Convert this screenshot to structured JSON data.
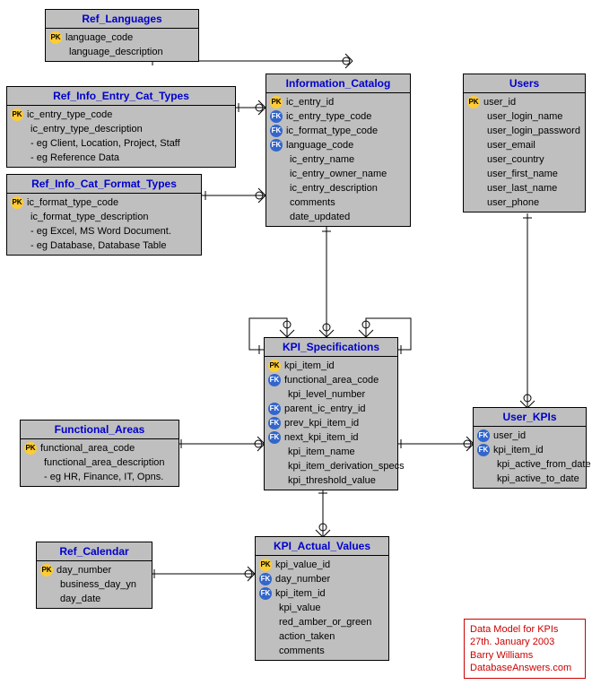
{
  "entities": {
    "ref_languages": {
      "title": "Ref_Languages",
      "attrs": [
        {
          "key": "pk",
          "name": "language_code"
        },
        {
          "key": "",
          "name": "language_description"
        }
      ]
    },
    "ref_info_entry_cat_types": {
      "title": "Ref_Info_Entry_Cat_Types",
      "attrs": [
        {
          "key": "pk",
          "name": "ic_entry_type_code"
        },
        {
          "key": "",
          "name": "ic_entry_type_description"
        },
        {
          "key": "",
          "name": "- eg Client, Location, Project, Staff"
        },
        {
          "key": "",
          "name": "- eg Reference Data"
        }
      ]
    },
    "ref_info_cat_format_types": {
      "title": "Ref_Info_Cat_Format_Types",
      "attrs": [
        {
          "key": "pk",
          "name": "ic_format_type_code"
        },
        {
          "key": "",
          "name": "ic_format_type_description"
        },
        {
          "key": "",
          "name": "- eg Excel, MS Word Document."
        },
        {
          "key": "",
          "name": "- eg Database, Database Table"
        }
      ]
    },
    "information_catalog": {
      "title": "Information_Catalog",
      "attrs": [
        {
          "key": "pk",
          "name": "ic_entry_id"
        },
        {
          "key": "fk",
          "name": "ic_entry_type_code"
        },
        {
          "key": "fk",
          "name": "ic_format_type_code"
        },
        {
          "key": "fk",
          "name": "language_code"
        },
        {
          "key": "",
          "name": "ic_entry_name"
        },
        {
          "key": "",
          "name": "ic_entry_owner_name"
        },
        {
          "key": "",
          "name": "ic_entry_description"
        },
        {
          "key": "",
          "name": "comments"
        },
        {
          "key": "",
          "name": "date_updated"
        }
      ]
    },
    "users": {
      "title": "Users",
      "attrs": [
        {
          "key": "pk",
          "name": "user_id"
        },
        {
          "key": "",
          "name": "user_login_name"
        },
        {
          "key": "",
          "name": "user_login_password"
        },
        {
          "key": "",
          "name": "user_email"
        },
        {
          "key": "",
          "name": "user_country"
        },
        {
          "key": "",
          "name": "user_first_name"
        },
        {
          "key": "",
          "name": "user_last_name"
        },
        {
          "key": "",
          "name": "user_phone"
        }
      ]
    },
    "kpi_specifications": {
      "title": "KPI_Specifications",
      "attrs": [
        {
          "key": "pk",
          "name": "kpi_item_id"
        },
        {
          "key": "fk",
          "name": "functional_area_code"
        },
        {
          "key": "",
          "name": "kpi_level_number"
        },
        {
          "key": "fk",
          "name": "parent_ic_entry_id"
        },
        {
          "key": "fk",
          "name": "prev_kpi_item_id"
        },
        {
          "key": "fk",
          "name": "next_kpi_item_id"
        },
        {
          "key": "",
          "name": "kpi_item_name"
        },
        {
          "key": "",
          "name": "kpi_item_derivation_specs"
        },
        {
          "key": "",
          "name": "kpi_threshold_value"
        }
      ]
    },
    "user_kpis": {
      "title": "User_KPIs",
      "attrs": [
        {
          "key": "fk",
          "name": "user_id"
        },
        {
          "key": "fk",
          "name": "kpi_item_id"
        },
        {
          "key": "",
          "name": "kpi_active_from_date"
        },
        {
          "key": "",
          "name": "kpi_active_to_date"
        }
      ]
    },
    "functional_areas": {
      "title": "Functional_Areas",
      "attrs": [
        {
          "key": "pk",
          "name": "functional_area_code"
        },
        {
          "key": "",
          "name": "functional_area_description"
        },
        {
          "key": "",
          "name": "- eg HR, Finance, IT, Opns."
        }
      ]
    },
    "ref_calendar": {
      "title": "Ref_Calendar",
      "attrs": [
        {
          "key": "pk",
          "name": "day_number"
        },
        {
          "key": "",
          "name": "business_day_yn"
        },
        {
          "key": "",
          "name": "day_date"
        }
      ]
    },
    "kpi_actual_values": {
      "title": "KPI_Actual_Values",
      "attrs": [
        {
          "key": "pk",
          "name": "kpi_value_id"
        },
        {
          "key": "fk",
          "name": "day_number"
        },
        {
          "key": "fk",
          "name": "kpi_item_id"
        },
        {
          "key": "",
          "name": "kpi_value"
        },
        {
          "key": "",
          "name": "red_amber_or_green"
        },
        {
          "key": "",
          "name": "action_taken"
        },
        {
          "key": "",
          "name": "comments"
        }
      ]
    }
  },
  "note": {
    "line1": "Data Model for KPIs",
    "line2": "27th. January 2003",
    "line3": "Barry Williams",
    "line4": "DatabaseAnswers.com"
  }
}
